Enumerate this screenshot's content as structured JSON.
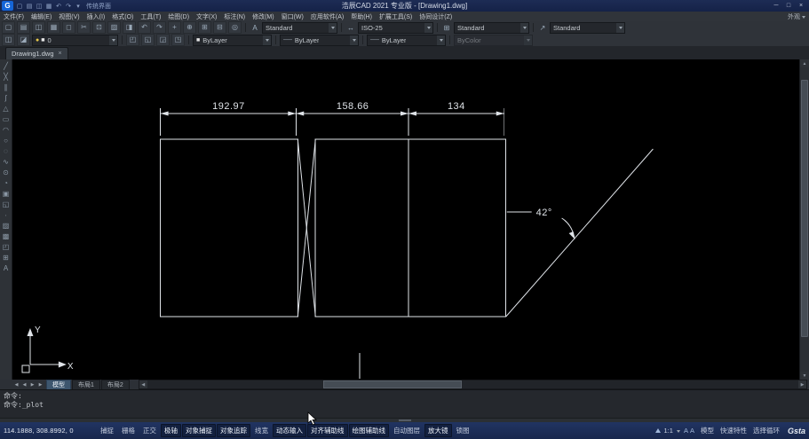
{
  "colors": {
    "titlebar_bg": "#182750",
    "statusbar_bg": "#1b2a50",
    "toolbar_bg": "#2f3339",
    "canvas_bg": "#000000",
    "line_color": "#dfe3e8",
    "accent_blue": "#1565d8"
  },
  "app": {
    "logo_letter": "G",
    "title": "浩辰CAD 2021 专业版 - [Drawing1.dwg]",
    "workspace": "传统界面",
    "minimize": "─",
    "maximize": "□",
    "close": "×"
  },
  "titlebar_icons": [
    {
      "name": "qat-new-icon",
      "glyph": "▢"
    },
    {
      "name": "qat-open-icon",
      "glyph": "▤"
    },
    {
      "name": "qat-save-icon",
      "glyph": "◫"
    },
    {
      "name": "qat-print-icon",
      "glyph": "▦"
    },
    {
      "name": "qat-undo-icon",
      "glyph": "↶"
    },
    {
      "name": "qat-redo-icon",
      "glyph": "↷"
    },
    {
      "name": "qat-dropdown-icon",
      "glyph": "▾"
    }
  ],
  "menubar": {
    "items": [
      {
        "label": "文件(F)",
        "name": "menu-file"
      },
      {
        "label": "编辑(E)",
        "name": "menu-edit"
      },
      {
        "label": "视图(V)",
        "name": "menu-view"
      },
      {
        "label": "插入(I)",
        "name": "menu-insert"
      },
      {
        "label": "格式(O)",
        "name": "menu-format"
      },
      {
        "label": "工具(T)",
        "name": "menu-tools"
      },
      {
        "label": "绘图(D)",
        "name": "menu-draw"
      },
      {
        "label": "文字(X)",
        "name": "menu-text"
      },
      {
        "label": "标注(N)",
        "name": "menu-dimension"
      },
      {
        "label": "修改(M)",
        "name": "menu-modify"
      },
      {
        "label": "窗口(W)",
        "name": "menu-window"
      },
      {
        "label": "应用软件(A)",
        "name": "menu-applications"
      },
      {
        "label": "帮助(H)",
        "name": "menu-help"
      },
      {
        "label": "扩展工具(S)",
        "name": "menu-express-tools"
      },
      {
        "label": "协同设计(Z)",
        "name": "menu-collaboration"
      }
    ],
    "right_label": "外观"
  },
  "toolbar_row1": {
    "icons": [
      {
        "name": "new-icon",
        "glyph": "▢"
      },
      {
        "name": "open-icon",
        "glyph": "▤"
      },
      {
        "name": "save-icon",
        "glyph": "◫"
      },
      {
        "name": "plot-icon",
        "glyph": "▦"
      },
      {
        "name": "plot-preview-icon",
        "glyph": "◻"
      },
      {
        "name": "cut-icon",
        "glyph": "✂"
      },
      {
        "name": "copy-icon",
        "glyph": "⊡"
      },
      {
        "name": "paste-icon",
        "glyph": "▨"
      },
      {
        "name": "match-properties-icon",
        "glyph": "◨"
      },
      {
        "name": "undo-icon",
        "glyph": "↶"
      },
      {
        "name": "redo-icon",
        "glyph": "↷"
      },
      {
        "name": "pan-icon",
        "glyph": "+"
      },
      {
        "name": "zoom-realtime-icon",
        "glyph": "⊕"
      },
      {
        "name": "zoom-window-icon",
        "glyph": "⊞"
      },
      {
        "name": "zoom-previous-icon",
        "glyph": "⊟"
      },
      {
        "name": "zoom-extents-icon",
        "glyph": "◎"
      }
    ],
    "text_style_icon": "A",
    "text_style": "Standard",
    "dim_style_icon": "↔",
    "dim_style": "ISO-25",
    "table_style_icon": "⊞",
    "table_style": "Standard",
    "mleader_style_icon": "↗",
    "mleader_style": "Standard"
  },
  "toolbar_row2": {
    "left_icons": [
      {
        "name": "layer-properties-icon",
        "glyph": "◫"
      },
      {
        "name": "layer-states-icon",
        "glyph": "◪"
      }
    ],
    "layer_chips": [
      {
        "name": "layer-on-icon",
        "glyph": "●",
        "cls": "chip-yellow"
      },
      {
        "name": "layer-color-chip",
        "glyph": "■",
        "cls": "chip-white"
      }
    ],
    "layer_value": "0",
    "mid_icons": [
      {
        "name": "make-object-layer-current-icon",
        "glyph": "◰"
      },
      {
        "name": "layer-previous-icon",
        "glyph": "◱"
      },
      {
        "name": "layer-walk-icon",
        "glyph": "◲"
      },
      {
        "name": "layer-isolate-icon",
        "glyph": "◳"
      }
    ],
    "color_value": "ByLayer",
    "linetype_value": "ByLayer",
    "lineweight_value": "ByLayer",
    "plot_style_value": "ByColor"
  },
  "doc_tab": {
    "label": "Drawing1.dwg",
    "close": "×"
  },
  "palette_icons": [
    {
      "name": "line-icon",
      "glyph": "╱"
    },
    {
      "name": "construction-line-icon",
      "glyph": "╳"
    },
    {
      "name": "multiline-icon",
      "glyph": "∥"
    },
    {
      "name": "polyline-icon",
      "glyph": "ʃ"
    },
    {
      "name": "polygon-icon",
      "glyph": "△"
    },
    {
      "name": "rectangle-icon",
      "glyph": "▭"
    },
    {
      "name": "arc-icon",
      "glyph": "◠"
    },
    {
      "name": "circle-icon",
      "glyph": "○"
    },
    {
      "name": "revision-cloud-icon",
      "glyph": "◌"
    },
    {
      "name": "spline-icon",
      "glyph": "∿"
    },
    {
      "name": "ellipse-icon",
      "glyph": "⊙"
    },
    {
      "name": "ellipse-arc-icon",
      "glyph": "◔"
    },
    {
      "name": "insert-block-icon",
      "glyph": "▣"
    },
    {
      "name": "make-block-icon",
      "glyph": "◱"
    },
    {
      "name": "point-icon",
      "glyph": "∙"
    },
    {
      "name": "hatch-icon",
      "glyph": "▨"
    },
    {
      "name": "gradient-icon",
      "glyph": "▩"
    },
    {
      "name": "region-icon",
      "glyph": "◰"
    },
    {
      "name": "table-icon",
      "glyph": "⊞"
    },
    {
      "name": "mtext-icon",
      "glyph": "A"
    }
  ],
  "drawing": {
    "dim1": "192.97",
    "dim2": "158.66",
    "dim3": "134",
    "angle": "42°",
    "ucs_x": "X",
    "ucs_y": "Y"
  },
  "layout_bar": {
    "tabs": [
      {
        "label": "模型",
        "name": "tab-model",
        "on": true
      },
      {
        "label": "布局1",
        "name": "tab-layout1"
      },
      {
        "label": "布局2",
        "name": "tab-layout2"
      }
    ]
  },
  "command": {
    "line1": "命令:",
    "line2": "命令:_plot"
  },
  "statusbar": {
    "coords": "114.1888, 308.8992, 0",
    "toggles": [
      {
        "label": "捕捉",
        "name": "snap-toggle"
      },
      {
        "label": "栅格",
        "name": "grid-toggle"
      },
      {
        "label": "正交",
        "name": "ortho-toggle"
      },
      {
        "label": "极轴",
        "name": "polar-toggle",
        "on": true
      },
      {
        "label": "对象捕捉",
        "name": "osnap-toggle",
        "on": true
      },
      {
        "label": "对象追踪",
        "name": "otrack-toggle",
        "on": true
      },
      {
        "label": "线宽",
        "name": "lineweight-toggle"
      },
      {
        "label": "动态输入",
        "name": "dynamic-input-toggle",
        "on": true
      },
      {
        "label": "对齐辅助线",
        "name": "align-guides-toggle",
        "on": true
      },
      {
        "label": "绘图辅助线",
        "name": "drafting-guides-toggle",
        "on": true
      },
      {
        "label": "自动图层",
        "name": "auto-layer-toggle"
      },
      {
        "label": "放大镜",
        "name": "magnifier-toggle",
        "on": true
      },
      {
        "label": "锁图",
        "name": "lock-drawing-toggle"
      }
    ],
    "scale": "1:1",
    "annotation_icons": [
      {
        "name": "annotation-visibility-icon",
        "glyph": "A"
      },
      {
        "name": "annotation-autoscale-icon",
        "glyph": "A"
      }
    ],
    "right_buttons": [
      {
        "label": "模型",
        "name": "model-space-button"
      },
      {
        "label": "快速特性",
        "name": "quick-properties-button"
      },
      {
        "label": "选择循环",
        "name": "selection-cycling-button"
      }
    ],
    "brand": "Gsta"
  }
}
